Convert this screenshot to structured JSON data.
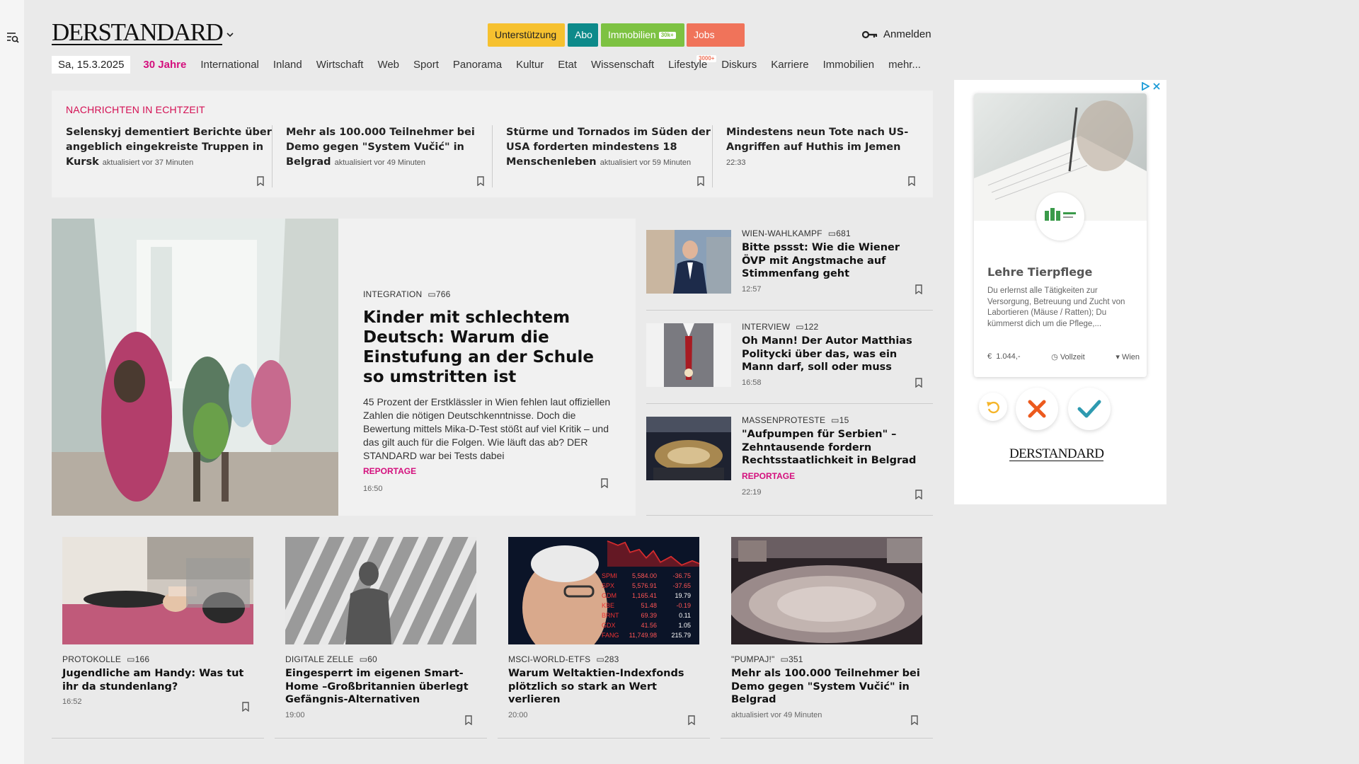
{
  "header": {
    "logo": "DERSTANDARD",
    "pills": {
      "support": "Unterstützung",
      "abo": "Abo",
      "immobilien": "Immobilien",
      "immobilien_badge": "30k+",
      "jobs": "Jobs",
      "jobs_badge": "3000+"
    },
    "login": "Anmelden"
  },
  "nav": {
    "date": "Sa, 15.3.2025",
    "items": [
      "30 Jahre",
      "International",
      "Inland",
      "Wirtschaft",
      "Web",
      "Sport",
      "Panorama",
      "Kultur",
      "Etat",
      "Wissenschaft",
      "Lifestyle",
      "Diskurs",
      "Karriere",
      "Immobilien",
      "mehr..."
    ]
  },
  "ticker": {
    "heading": "Nachrichten in Echtzeit",
    "items": [
      {
        "title": "Selenskyj dementiert Berichte über angeblich eingekreiste Truppen in Kursk",
        "update": "aktualisiert vor 37 Minuten"
      },
      {
        "title": "Mehr als 100.000 Teilnehmer bei Demo gegen \"System Vučić\" in Belgrad",
        "update": "aktualisiert vor 49 Minuten"
      },
      {
        "title": "Stürme und Tornados im Süden der USA forderten mindestens 18 Menschenleben",
        "update": "aktualisiert vor 59 Minuten"
      },
      {
        "title": "Mindestens neun Tote nach US-Angriffen auf Huthis im Jemen",
        "update": "22:33"
      }
    ]
  },
  "hero": {
    "kicker": "Integration",
    "comments": "766",
    "title": "Kinder mit schlechtem Deutsch: Warum die Einstufung an der Schule so umstritten ist",
    "lead": "45 Prozent der Erstklässler in Wien fehlen laut offiziellen Zahlen die nötigen Deutschkenntnisse. Doch die Bewertung mittels Mika-D-Test stößt auf viel Kritik – und das gilt auch für die Folgen. Wie läuft das ab? DER STANDARD war bei Tests dabei",
    "tag": "Reportage",
    "time": "16:50"
  },
  "side": [
    {
      "kicker": "Wien-Wahlkampf",
      "comments": "681",
      "title": "Bitte pssst: Wie die Wiener ÖVP mit Angstmache auf Stimmenfang geht",
      "tag": "",
      "time": "12:57"
    },
    {
      "kicker": "Interview",
      "comments": "122",
      "title": "Oh Mann! Der Autor Matthias Politycki über das, was ein Mann darf, soll oder muss",
      "tag": "",
      "time": "16:58"
    },
    {
      "kicker": "Massenproteste",
      "comments": "15",
      "title": "\"Aufpumpen für Serbien\" – Zehntausende fordern Rechtsstaatlichkeit in Belgrad",
      "tag": "Reportage",
      "time": "22:19"
    }
  ],
  "cards": [
    {
      "kicker": "Protokolle",
      "comments": "166",
      "title": "Jugendliche am Handy: Was tut ihr da stundenlang?",
      "time": "16:52"
    },
    {
      "kicker": "Digitale Zelle",
      "comments": "60",
      "title": "Eingesperrt im eigenen Smart-Home –Großbritannien überlegt Gefängnis-Alternativen",
      "time": "19:00"
    },
    {
      "kicker": "MSCI-World-ETFs",
      "comments": "283",
      "title": "Warum Weltaktien-Indexfonds plötzlich so stark an Wert verlieren",
      "time": "20:00"
    },
    {
      "kicker": "\"Pumpaj!\"",
      "comments": "351",
      "title": "Mehr als 100.000 Teilnehmer bei Demo gegen \"System Vučić\" in Belgrad",
      "time": "aktualisiert vor 49 Minuten"
    }
  ],
  "ad": {
    "title": "Lehre Tierpflege",
    "description": "Du erlernst alle Tätigkeiten zur Versorgung, Betreuung und Zucht von Labortieren (Mäuse / Ratten); Du kümmerst dich um die Pflege,...",
    "salary": "1.044,-",
    "salary_symbol": "€",
    "type": "Vollzeit",
    "location": "Wien",
    "brand": "DERSTANDARD"
  },
  "ticker_symbols": [
    {
      "sym": "SPMI",
      "v": "5,584.00",
      "c": "-36.75"
    },
    {
      "sym": "SPX",
      "v": "5,576.91",
      "c": "-37.65"
    },
    {
      "sym": "GDM",
      "v": "1,165.41",
      "c": "19.79"
    },
    {
      "sym": "KBE",
      "v": "51.48",
      "c": "-0.19"
    },
    {
      "sym": "BRNT",
      "v": "69.39",
      "c": "0.11"
    },
    {
      "sym": "GDX",
      "v": "41.56",
      "c": "1.05"
    },
    {
      "sym": "FANG",
      "v": "11,749.98",
      "c": "215.79"
    }
  ],
  "colors": {
    "accent_red": "#d40f53",
    "accent_pink": "#d40f7d",
    "teal": "#0d8a8a"
  }
}
